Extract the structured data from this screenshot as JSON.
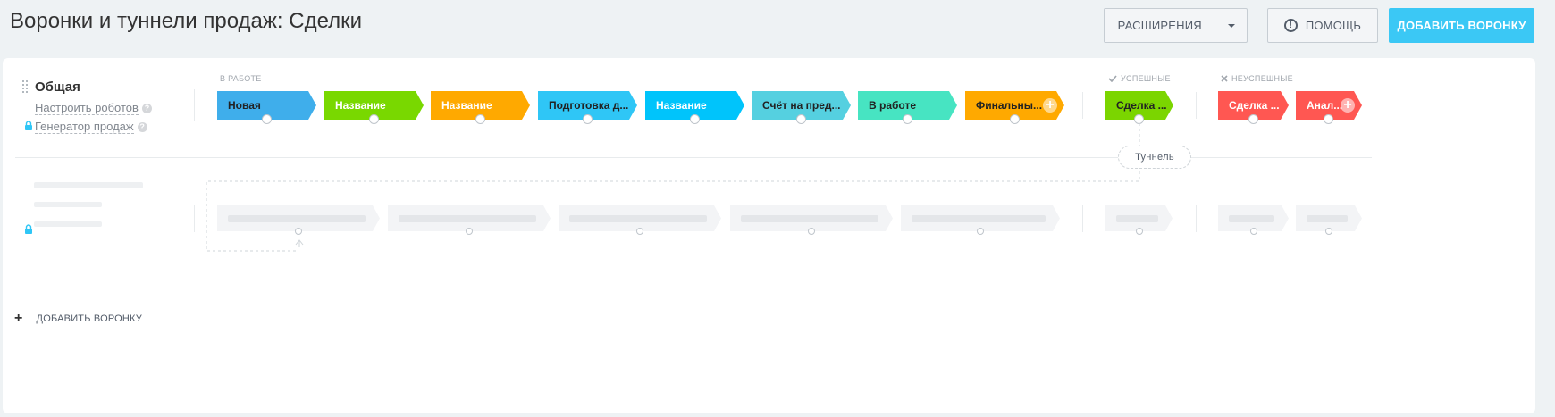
{
  "header": {
    "title": "Воронки и туннели продаж: Сделки",
    "extensions_label": "Расширения",
    "help_label": "Помощь",
    "add_funnel_label": "Добавить воронку"
  },
  "funnel": {
    "name": "Общая",
    "robots_link": "Настроить роботов",
    "generator_link": "Генератор продаж",
    "help_mark": "?"
  },
  "groups": {
    "in_work": "В работе",
    "success": "Успешные",
    "failure": "Неуспешные"
  },
  "stages": [
    {
      "label": "Новая",
      "color": "#3faeeb",
      "text_color": "#222"
    },
    {
      "label": "Название",
      "color": "#79d800",
      "text_color": "#fff"
    },
    {
      "label": "Название",
      "color": "#ffa900",
      "text_color": "#fff"
    },
    {
      "label": "Подготовка д...",
      "color": "#2fc6f6",
      "text_color": "#222"
    },
    {
      "label": "Название",
      "color": "#00c4fb",
      "text_color": "#fff"
    },
    {
      "label": "Счёт на пред...",
      "color": "#55d0e0",
      "text_color": "#222"
    },
    {
      "label": "В работе",
      "color": "#47e4c2",
      "text_color": "#222"
    },
    {
      "label": "Финальны...",
      "color": "#ffa900",
      "text_color": "#222"
    }
  ],
  "success_stages": [
    {
      "label": "Сделка ...",
      "color": "#7bd500",
      "text_color": "#222"
    }
  ],
  "failure_stages": [
    {
      "label": "Сделка ...",
      "color": "#ff5752",
      "text_color": "#fff"
    },
    {
      "label": "Анал...",
      "color": "#ff5752",
      "text_color": "#fff"
    }
  ],
  "tunnel_label": "Туннель",
  "add_funnel_link": "Добавить воронку",
  "colors": {
    "accent": "#3bc8f5",
    "background": "#eef2f4"
  }
}
